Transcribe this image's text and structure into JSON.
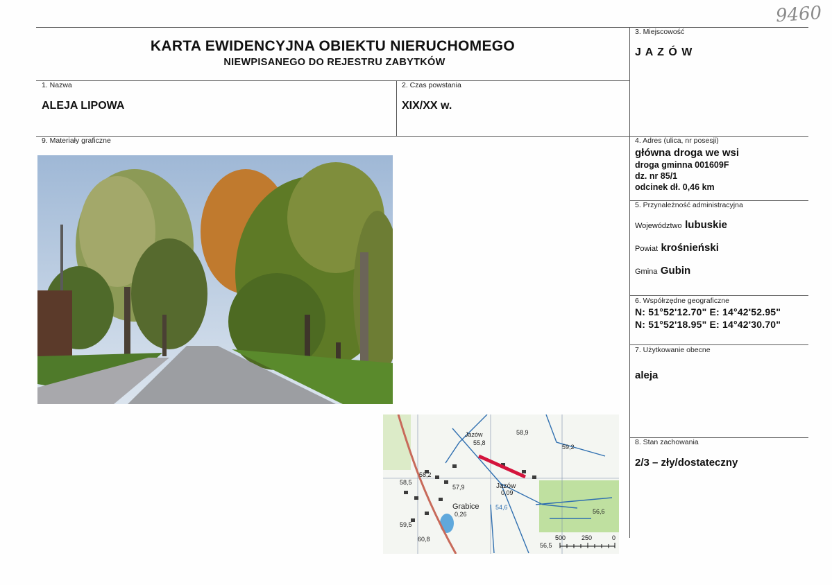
{
  "handwritten_number": "9460",
  "header": {
    "title": "KARTA EWIDENCYJNA OBIEKTU NIERUCHOMEGO",
    "subtitle": "NIEWPISANEGO DO REJESTRU ZABYTKÓW"
  },
  "fields": {
    "miejscowosc": {
      "label": "3. Miejscowość",
      "value": "J A Z Ó W"
    },
    "nazwa": {
      "label": "1. Nazwa",
      "value": "ALEJA LIPOWA"
    },
    "czas": {
      "label": "2. Czas powstania",
      "value": "XIX/XX w."
    },
    "materialy": {
      "label": "9. Materiały graficzne"
    },
    "adres": {
      "label": "4. Adres (ulica, nr posesji)",
      "line1": "główna droga we wsi",
      "line2": "droga gminna 001609F",
      "line3": "dz. nr 85/1",
      "line4": "odcinek dł. 0,46 km"
    },
    "przynaleznosc": {
      "label": "5. Przynależność administracyjna",
      "woj_key": "Województwo",
      "woj_val": "lubuskie",
      "pow_key": "Powiat",
      "pow_val": "krośnieński",
      "gm_key": "Gmina",
      "gm_val": "Gubin"
    },
    "wspolrzedne": {
      "label": "6. Współrzędne geograficzne",
      "line1": "N: 51°52'12.70\"  E: 14°42'52.95\"",
      "line2": "N: 51°52'18.95\"  E: 14°42'30.70\""
    },
    "uzytkowanie": {
      "label": "7. Użytkowanie obecne",
      "value": "aleja"
    },
    "stan": {
      "label": "8. Stan zachowania",
      "value": "2/3 – zły/dostateczny"
    }
  },
  "map": {
    "labels": [
      "Jazów",
      "55,8",
      "58,9",
      "59,2",
      "58,2",
      "58,5",
      "57,9",
      "Jazów",
      "0,09",
      "Grabice",
      "0,26",
      "54,6",
      "56,6",
      "59,5",
      "60,8",
      "56,5"
    ],
    "scale": [
      "500",
      "250",
      "0"
    ],
    "road_color": "#d4143c"
  },
  "colors": {
    "line": "#555555",
    "map_bg": "#f4f6f2",
    "map_blue": "#2f6fb0"
  }
}
